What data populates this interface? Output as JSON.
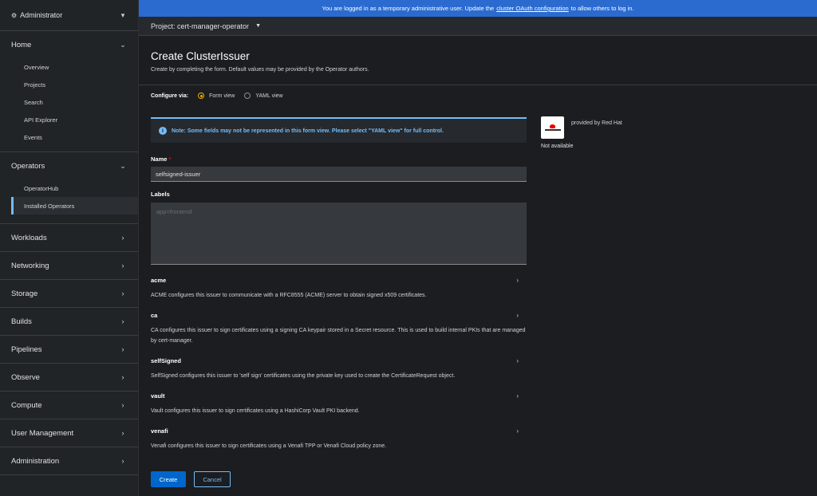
{
  "sidebar": {
    "perspective": "Administrator",
    "home": {
      "label": "Home",
      "items": [
        "Overview",
        "Projects",
        "Search",
        "API Explorer",
        "Events"
      ]
    },
    "operators": {
      "label": "Operators",
      "items": [
        "OperatorHub",
        "Installed Operators"
      ]
    },
    "sections": [
      "Workloads",
      "Networking",
      "Storage",
      "Builds",
      "Pipelines",
      "Observe",
      "Compute",
      "User Management",
      "Administration"
    ]
  },
  "banner": {
    "prefix": "You are logged in as a temporary administrative user. Update the",
    "link": "cluster OAuth configuration",
    "suffix": "to allow others to log in."
  },
  "project": {
    "label": "Project: cert-manager-operator"
  },
  "page": {
    "title": "Create ClusterIssuer",
    "description": "Create by completing the form. Default values may be provided by the Operator authors."
  },
  "configure": {
    "label": "Configure via:",
    "form_view": "Form view",
    "yaml_view": "YAML view"
  },
  "alert": {
    "text": "Note: Some fields may not be represented in this form view. Please select \"YAML view\" for full control."
  },
  "provider": {
    "by": "provided by Red Hat",
    "status": "Not available"
  },
  "form": {
    "name_label": "Name",
    "name_required": "*",
    "name_value": "selfsigned-issuer",
    "labels_label": "Labels",
    "labels_placeholder": "app=frontend",
    "groups": [
      {
        "name": "acme",
        "desc": "ACME configures this issuer to communicate with a RFC8555 (ACME) server to obtain signed x509 certificates."
      },
      {
        "name": "ca",
        "desc": "CA configures this issuer to sign certificates using a signing CA keypair stored in a Secret resource. This is used to build internal PKIs that are managed by cert-manager."
      },
      {
        "name": "selfSigned",
        "desc": "SelfSigned configures this issuer to 'self sign' certificates using the private key used to create the CertificateRequest object."
      },
      {
        "name": "vault",
        "desc": "Vault configures this issuer to sign certificates using a HashiCorp Vault PKI backend."
      },
      {
        "name": "venafi",
        "desc": "Venafi configures this issuer to sign certificates using a Venafi TPP or Venafi Cloud policy zone."
      }
    ]
  },
  "buttons": {
    "create": "Create",
    "cancel": "Cancel"
  },
  "colors": {
    "accent": "#0066cc",
    "link": "#73bcf7",
    "banner": "#2b6bd0"
  }
}
